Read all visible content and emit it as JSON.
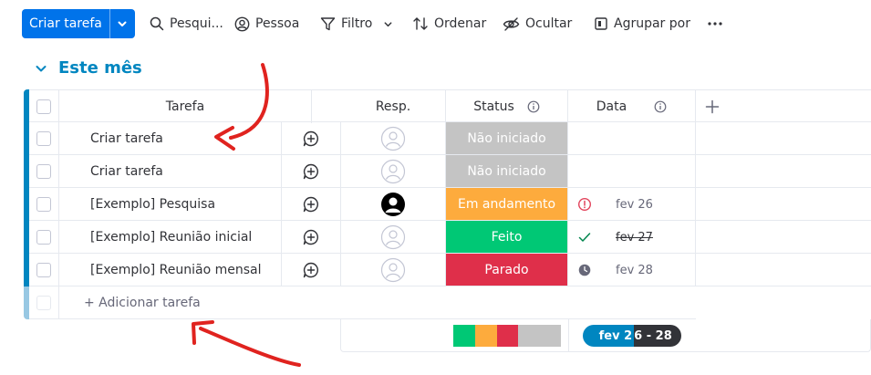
{
  "toolbar": {
    "primary_label": "Criar tarefa",
    "search_label": "Pesqui...",
    "person_label": "Pessoa",
    "filter_label": "Filtro",
    "sort_label": "Ordenar",
    "hide_label": "Ocultar",
    "group_label": "Agrupar por"
  },
  "group": {
    "title": "Este mês",
    "color": "#0086c0"
  },
  "columns": {
    "task": "Tarefa",
    "resp": "Resp.",
    "status": "Status",
    "date": "Data"
  },
  "rows": [
    {
      "task": "Criar tarefa",
      "status": "Não iniciado",
      "status_color": "#c4c4c4",
      "date": "",
      "date_icon": "",
      "resp": "empty-avatar"
    },
    {
      "task": "Criar tarefa",
      "status": "Não iniciado",
      "status_color": "#c4c4c4",
      "date": "",
      "date_icon": "",
      "resp": "empty-avatar"
    },
    {
      "task": "[Exemplo] Pesquisa",
      "status": "Em andamento",
      "status_color": "#fdab3d",
      "date": "fev 26",
      "date_icon": "overdue-alert-icon",
      "resp": "user-avatar"
    },
    {
      "task": "[Exemplo] Reunião inicial",
      "status": "Feito",
      "status_color": "#00c875",
      "date": "fev 27",
      "date_icon": "done-check-icon",
      "resp": "empty-avatar"
    },
    {
      "task": "[Exemplo] Reunião mensal",
      "status": "Parado",
      "status_color": "#df2f4a",
      "date": "fev 28",
      "date_icon": "clock-icon",
      "resp": "empty-avatar"
    }
  ],
  "add_task_label": "+ Adicionar tarefa",
  "summary": {
    "status_distribution": [
      {
        "color": "#00c875",
        "fraction": 0.2
      },
      {
        "color": "#fdab3d",
        "fraction": 0.2
      },
      {
        "color": "#df2f4a",
        "fraction": 0.2
      },
      {
        "color": "#c4c4c4",
        "fraction": 0.4
      }
    ],
    "date_range_start": "fev 2",
    "date_range_end": "6 - 28"
  }
}
